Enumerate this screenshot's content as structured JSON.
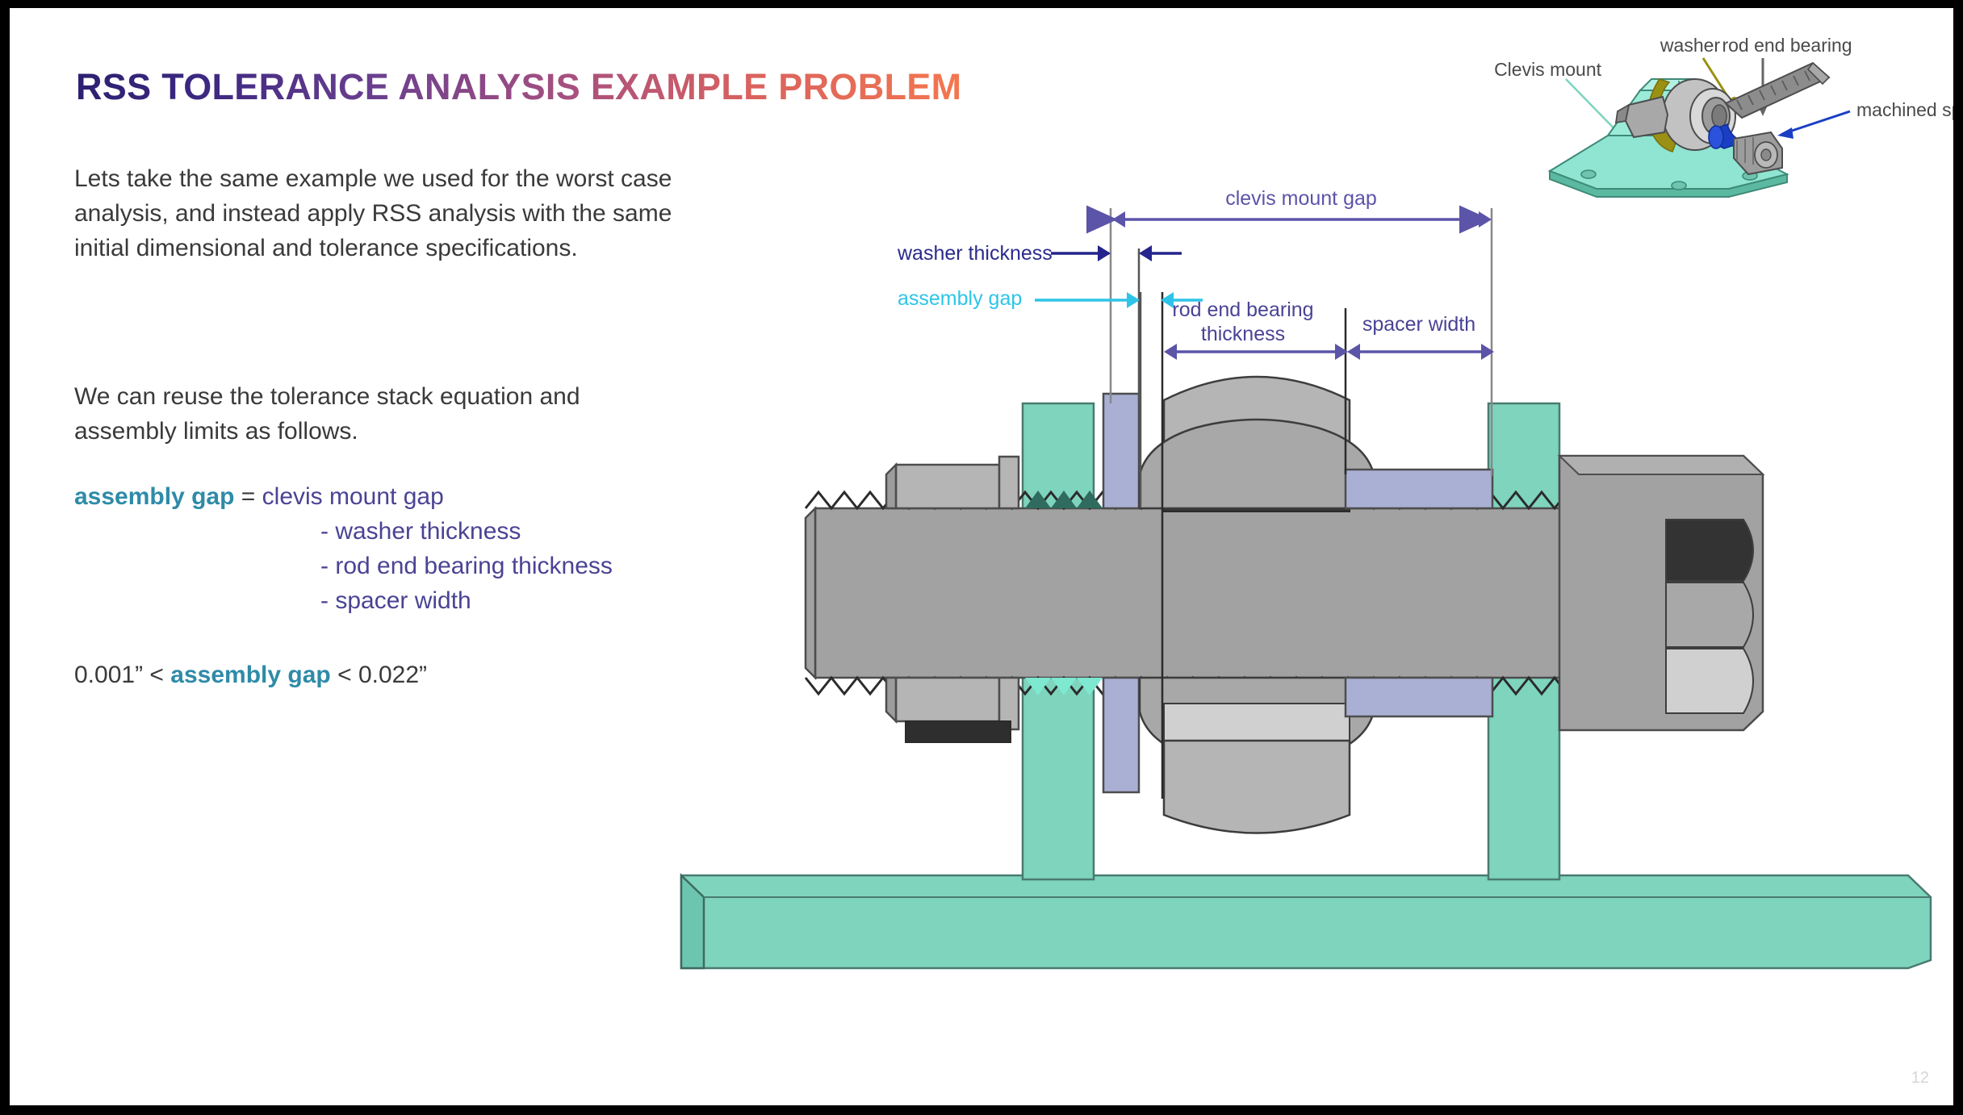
{
  "slide": {
    "title": "RSS TOLERANCE ANALYSIS EXAMPLE PROBLEM",
    "page_number": "12",
    "paragraph_1": "Lets take the same example we used for the worst case analysis, and instead apply RSS analysis with the same initial dimensional and tolerance specifications.",
    "paragraph_2": "We can reuse the tolerance stack equation and assembly limits as follows."
  },
  "equation": {
    "lhs": "assembly gap",
    "equals": "=",
    "rhs_first": "clevis mount gap",
    "rhs_terms": [
      "- washer thickness",
      "- rod end bearing thickness",
      "- spacer width"
    ]
  },
  "limits": {
    "lower": "0.001”",
    "op_left": "<",
    "variable": "assembly gap",
    "op_right": "<",
    "upper": "0.022”"
  },
  "drawing_labels": {
    "clevis_mount_gap": "clevis mount gap",
    "washer_thickness": "washer thickness",
    "assembly_gap": "assembly gap",
    "rod_end_bearing_thickness_line1": "rod end bearing",
    "rod_end_bearing_thickness_line2": "thickness",
    "spacer_width": "spacer width"
  },
  "thumbnail_callouts": {
    "washer": "washer",
    "rod_end_bearing": "rod end bearing",
    "clevis_mount": "Clevis mount",
    "machined_spacer": "machined spacer"
  },
  "colors": {
    "title_gradient_start": "#2e2070",
    "title_gradient_end": "#f3774f",
    "teal_accent": "#2e8ba8",
    "indigo_term": "#4a4394",
    "purple_dim": "#5b54a8",
    "navy_dim": "#2a2a8c",
    "cyan_dim": "#2ec4e8",
    "body_text": "#3a3a3a",
    "mint_part": "#7ed4bd",
    "lavender_part": "#aab0d4",
    "steel_gray": "#a8a8a8",
    "dark_gray": "#333333",
    "olive_washer": "#9a9013",
    "blue_spacer": "#1a3fc4"
  }
}
